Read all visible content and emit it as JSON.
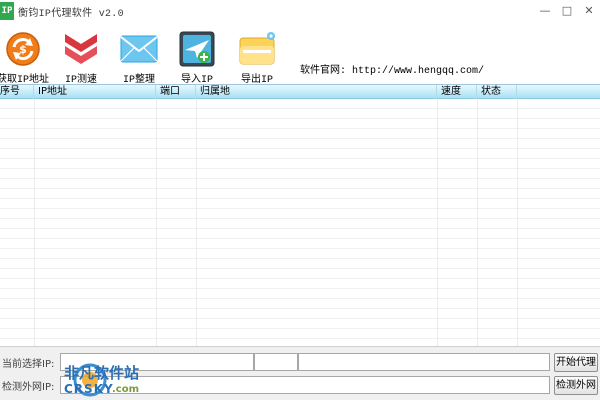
{
  "window": {
    "icon_text": "IP",
    "title": "衡钧IP代理软件 v2.0",
    "min_glyph": "—",
    "max_glyph": "□",
    "close_glyph": "✕"
  },
  "toolbar": {
    "items": [
      {
        "label": "获取IP地址",
        "icon": "refresh-dollar-icon"
      },
      {
        "label": "IP测速",
        "icon": "double-chevron-down-icon"
      },
      {
        "label": "IP整理",
        "icon": "envelope-icon"
      },
      {
        "label": "导入IP",
        "icon": "import-plane-icon"
      },
      {
        "label": "导出IP",
        "icon": "export-folder-icon"
      }
    ],
    "site_label": "软件官网: http://www.hengqq.com/"
  },
  "table": {
    "columns": [
      "序号",
      "IP地址",
      "端口",
      "归属地",
      "速度",
      "状态"
    ]
  },
  "bottom": {
    "current_label": "当前选择IP:",
    "detect_label": "检测外网IP:",
    "start_button": "开始代理",
    "detect_button": "检测外网"
  },
  "watermark": {
    "line1": "非凡软件站",
    "line2": "CRSKY",
    "line3": ".com"
  },
  "colors": {
    "accent_header": "#a9e1f3",
    "icon_orange": "#f07d1a",
    "icon_red": "#d9363e",
    "icon_blue": "#2aa5df",
    "app_green": "#2fa84f"
  }
}
